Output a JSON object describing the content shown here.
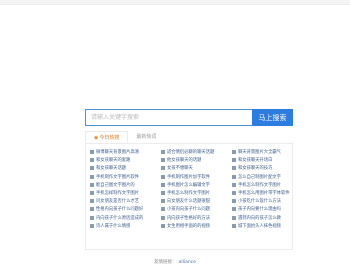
{
  "search": {
    "placeholder": "请输入关键字搜索",
    "button_label": "马上搜索"
  },
  "tabs": [
    {
      "label": "今日热搜",
      "active": true
    },
    {
      "label": "最新热词",
      "active": false
    }
  ],
  "keywords": [
    "微博聊天背景图片高清",
    "适合情侣必聊的聊天话题",
    "聊天背景图片大全霸气",
    "和女孩聊天的套路",
    "他女孩聊天的话题",
    "和女孩聊天开场白",
    "和女孩聊天话题",
    "女孩不想聊天",
    "和女孩聊天的技巧",
    "手机制作文字图片软件",
    "手机制作图片加字软件",
    "怎么自己制图片配文字",
    "能自己图文字图片的",
    "手机图片怎么编辑文字",
    "手机怎么制作文字图片",
    "手机怎样制作文字图片",
    "手机怎么制作文字图片",
    "手机怎么用图片带字体软件",
    "问女朋友是否什么才艺",
    "向女朋友什么话题很甜",
    "小孩吃什么饭什么方法",
    "性格内向孩子什么问题好",
    "小孩内向孩子什么问题",
    "孩子内向要什么理由吗",
    "内向孩子什么原因造成的",
    "内向孩子性格好的方法",
    "遇到内向的孩子怎么教",
    "诗人属于什么情感",
    "女生用相手面的的视频",
    "城下面抬头人抹色视频"
  ],
  "footer": {
    "label": "友情链接：",
    "link": "alliance"
  },
  "colors": {
    "accent": "#2d7ce0",
    "tab_active": "#e07a1f",
    "link": "#3a5b8a"
  }
}
